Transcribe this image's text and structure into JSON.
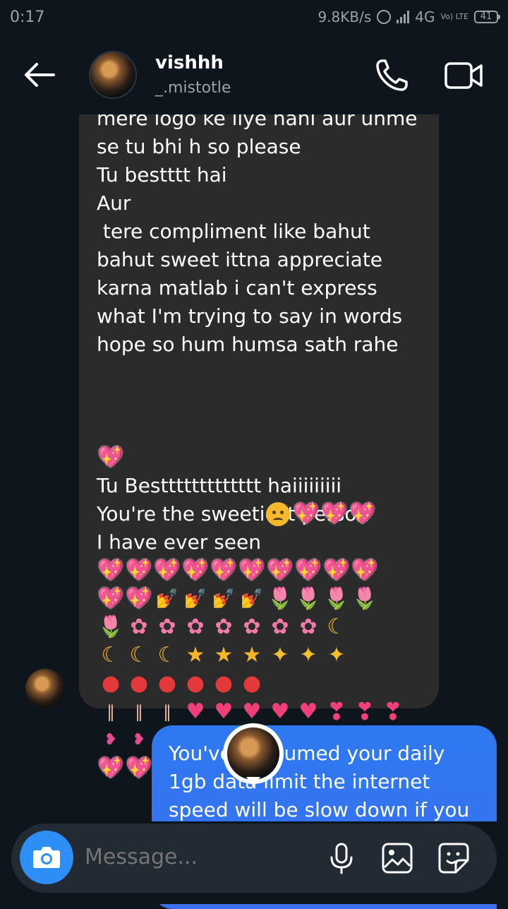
{
  "status": {
    "time": "0:17",
    "speed": "9.8KB/s",
    "network": "4G",
    "volte": "Vo) LTE",
    "battery": "41"
  },
  "header": {
    "name": "vishhh",
    "handle": "_.mistotle",
    "back_icon": "arrow-left-icon",
    "call_icon": "phone-icon",
    "video_icon": "video-camera-icon"
  },
  "received_message": {
    "text": "mere logo ke liye nahi aur unme\nse tu bhi h so please\nTu bestttt hai\nAur\n tere compliment like bahut\nbahut sweet ittna appreciate\nkarna matlab i can't express\nwhat I'm trying to say in words\nhope so hum humsa sath rahe",
    "emoji_line_1": "💖",
    "text_2": "Tu Besttttttttttttt haiiiiiiiii\nYou're the sweetiest person\nI have ever seen"
  },
  "sent_message": {
    "text": "You've consumed your daily\n1gb data limit the internet\nspeed will be slow down if you"
  },
  "composer": {
    "placeholder": "Message...",
    "camera_icon": "camera-icon",
    "mic_icon": "microphone-icon",
    "gallery_icon": "image-icon",
    "sticker_icon": "sticker-icon"
  },
  "colors": {
    "background": "#0e151c",
    "received_bubble": "#2b2b2b",
    "sent_bubble": "#3b6ff0",
    "accent": "#2d8ef5"
  }
}
